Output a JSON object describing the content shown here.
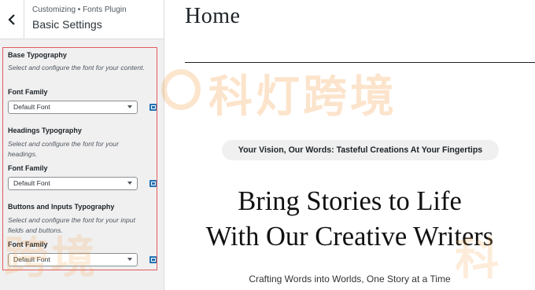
{
  "sidebar": {
    "breadcrumb": "Customizing • Fonts Plugin",
    "title": "Basic Settings",
    "groups": [
      {
        "title": "Base Typography",
        "description": "Select and configure the font for your content.",
        "field_label": "Font Family",
        "value": "Default Font"
      },
      {
        "title": "Headings Typography",
        "description": "Select and configure the font for your headings.",
        "field_label": "Font Family",
        "value": "Default Font"
      },
      {
        "title": "Buttons and Inputs Typography",
        "description": "Select and configure the font for your input fields and buttons.",
        "field_label": "Font Family",
        "value": "Default Font"
      }
    ]
  },
  "preview": {
    "page_title": "Home",
    "tagline": "Your Vision, Our Words: Tasteful Creations At Your Fingertips",
    "headline_line1": "Bring Stories to Life",
    "headline_line2": "With Our Creative Writers",
    "subtitle": "Crafting Words into Worlds, One Story at a Time"
  },
  "watermark": {
    "text": "科灯跨境",
    "bottom_text": "跨境",
    "right_text": "科"
  },
  "colors": {
    "highlight_border": "#e35a5a",
    "accent_blue": "#2271b1",
    "watermark": "#f6a24a"
  }
}
